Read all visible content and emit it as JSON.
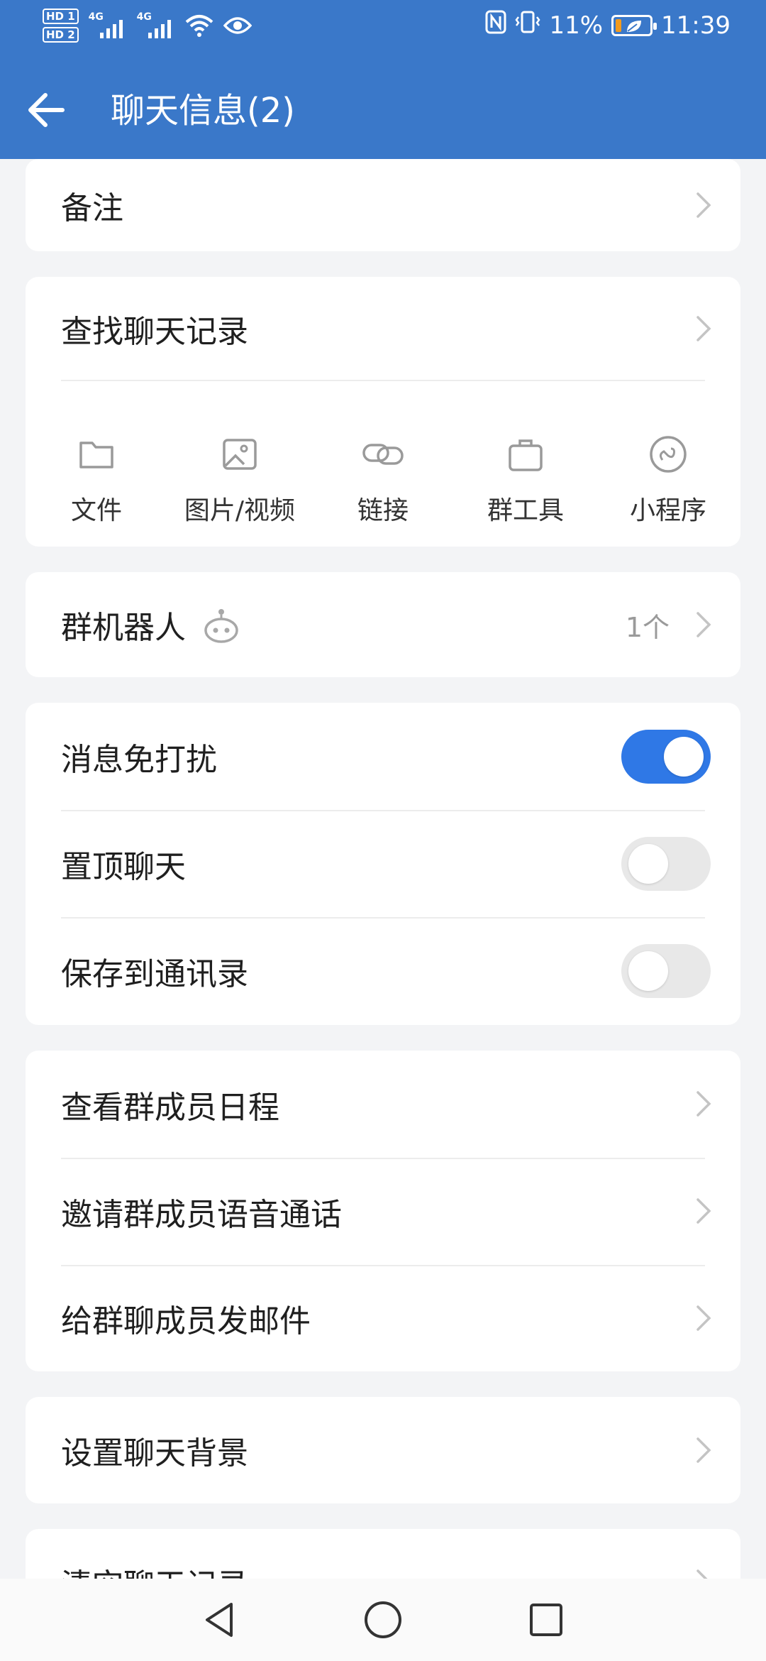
{
  "status_bar": {
    "hd1": "HD 1",
    "hd2": "HD 2",
    "net1": "4G",
    "net2": "4G",
    "battery_percent": "11%",
    "time": "11:39"
  },
  "header": {
    "title": "聊天信息(2)"
  },
  "cards": {
    "remark": {
      "label": "备注"
    },
    "search": {
      "label": "查找聊天记录",
      "tools": [
        {
          "label": "文件",
          "icon": "folder-icon"
        },
        {
          "label": "图片/视频",
          "icon": "image-icon"
        },
        {
          "label": "链接",
          "icon": "link-icon"
        },
        {
          "label": "群工具",
          "icon": "briefcase-icon"
        },
        {
          "label": "小程序",
          "icon": "mini-program-icon"
        }
      ]
    },
    "robot": {
      "label": "群机器人",
      "count": "1个"
    },
    "toggles": [
      {
        "label": "消息免打扰",
        "on": true
      },
      {
        "label": "置顶聊天",
        "on": false
      },
      {
        "label": "保存到通讯录",
        "on": false
      }
    ],
    "members": [
      {
        "label": "查看群成员日程"
      },
      {
        "label": "邀请群成员语音通话"
      },
      {
        "label": "给群聊成员发邮件"
      }
    ],
    "background": {
      "label": "设置聊天背景"
    },
    "clear": {
      "label": "清空聊天记录"
    }
  },
  "colors": {
    "header": "#3a78c9",
    "toggle_on": "#2f78e6",
    "page_bg": "#f3f4f6"
  }
}
